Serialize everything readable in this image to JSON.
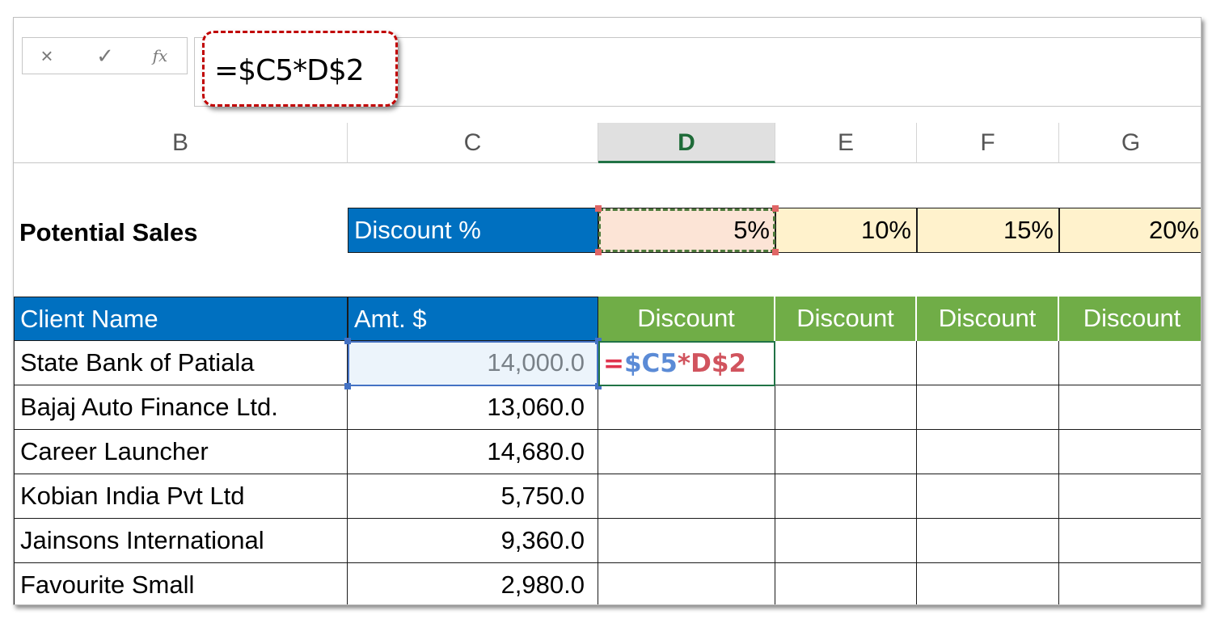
{
  "formula_bar": {
    "cancel_icon": "×",
    "enter_icon": "✓",
    "fx_label": "fx",
    "formula": "=$C5*D$2"
  },
  "columns": [
    "B",
    "C",
    "D",
    "E",
    "F",
    "G"
  ],
  "active_column": "D",
  "row2": {
    "label": "Potential Sales",
    "discount_label": "Discount %",
    "percents": [
      "5%",
      "10%",
      "15%",
      "20%"
    ]
  },
  "table": {
    "headers": [
      "Client Name",
      "Amt. $",
      "Discount",
      "Discount",
      "Discount",
      "Discount"
    ],
    "rows": [
      {
        "client": "State Bank of Patiala",
        "amount": "14,000.0"
      },
      {
        "client": "Bajaj Auto Finance Ltd.",
        "amount": "13,060.0"
      },
      {
        "client": "Career Launcher",
        "amount": "14,680.0"
      },
      {
        "client": "Kobian India Pvt Ltd",
        "amount": "5,750.0"
      },
      {
        "client": "Jainsons International",
        "amount": "9,360.0"
      },
      {
        "client": "Favourite Small",
        "amount": "2,980.0"
      }
    ]
  },
  "edit_cell": {
    "parts": [
      "=",
      "$C5",
      "*",
      "D$2"
    ]
  },
  "colors": {
    "blue_header": "#0070c0",
    "green_header": "#70ad47",
    "pct_fill": "#fff2cc",
    "selected_pct_fill": "#fce4d6"
  }
}
